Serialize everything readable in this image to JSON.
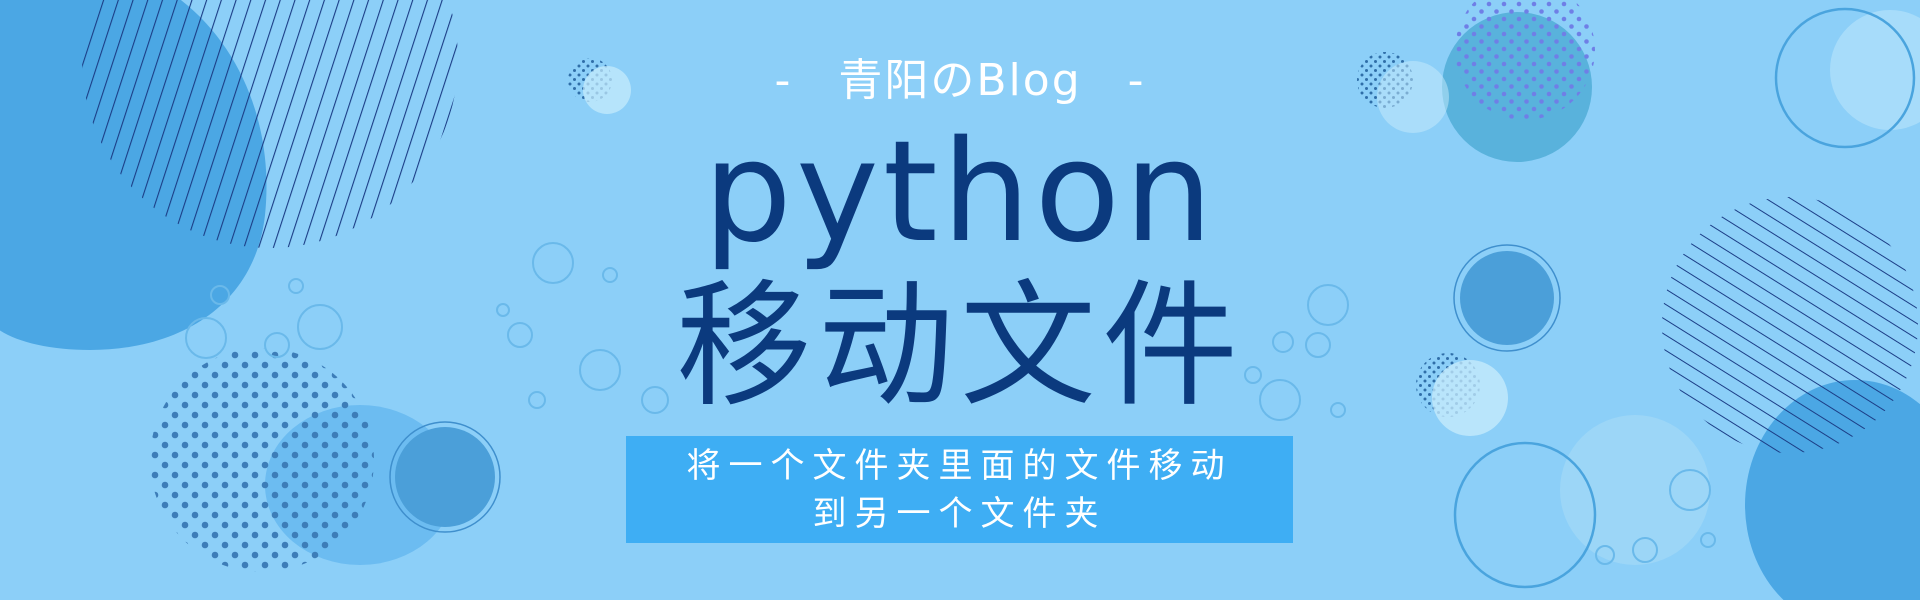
{
  "header": {
    "dash_left": "-",
    "blog_name": "青阳のBlog",
    "dash_right": "-"
  },
  "title": {
    "english": "python",
    "chinese": "移动文件"
  },
  "subtitle": {
    "line1": "将一个文件夹里面的文件移动",
    "line2": "到另一个文件夹"
  },
  "colors": {
    "background": "#8ccff8",
    "title": "#0b3a7e",
    "subtitle_box": "#3eaef4",
    "subtitle_text": "#ffffff"
  }
}
